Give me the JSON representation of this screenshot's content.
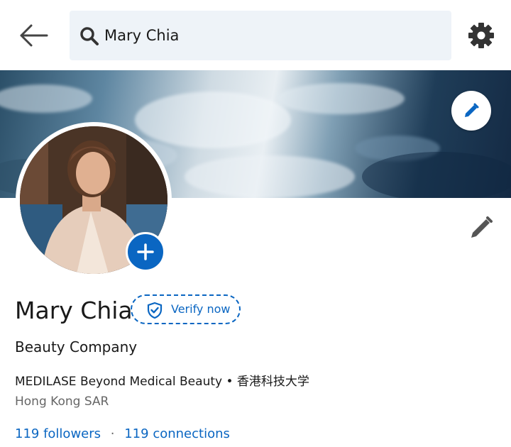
{
  "search": {
    "query": "Mary Chia"
  },
  "profile": {
    "name": "Mary Chia",
    "verify_label": "Verify now",
    "headline": "Beauty Company",
    "company": "MEDILASE Beyond Medical Beauty",
    "bullet": "•",
    "school": "香港科技大学",
    "location": "Hong Kong SAR",
    "followers": "119 followers",
    "separator": "·",
    "connections": "119 connections"
  },
  "colors": {
    "accent": "#0a66c2",
    "search_bg": "#eef3f8",
    "secondary_text": "#666666"
  },
  "icons": {
    "back": "arrow-left-icon",
    "search": "search-icon",
    "settings": "gear-icon",
    "edit_banner": "pencil-icon",
    "add_photo": "plus-icon",
    "edit_profile": "pencil-icon",
    "verify": "shield-check-icon"
  }
}
